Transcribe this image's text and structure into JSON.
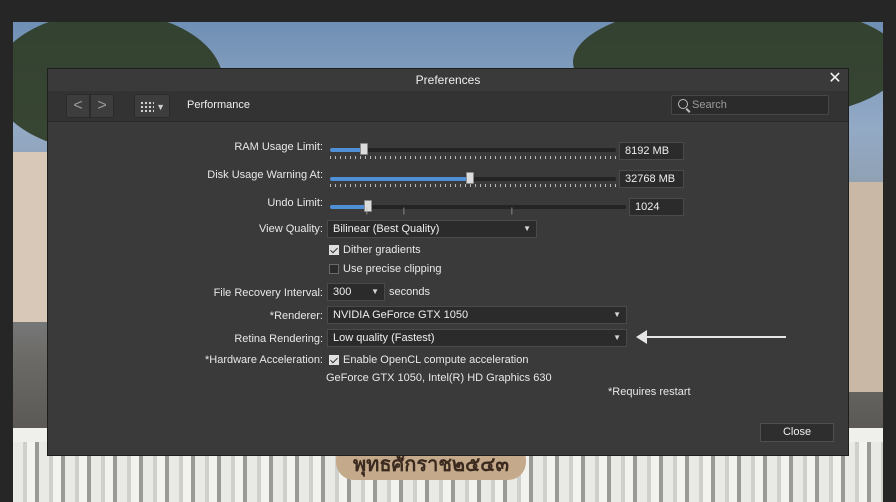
{
  "window": {
    "title": "Preferences"
  },
  "toolbar": {
    "back_glyph": "<",
    "forward_glyph": ">",
    "section_title": "Performance",
    "search_placeholder": "Search"
  },
  "settings": {
    "ram": {
      "label": "RAM Usage Limit:",
      "value": "8192 MB",
      "level": 0.12
    },
    "disk": {
      "label": "Disk Usage Warning At:",
      "value": "32768 MB",
      "level": 0.49
    },
    "undo": {
      "label": "Undo Limit:",
      "value": "1024",
      "level": 0.13
    },
    "view_quality": {
      "label": "View Quality:",
      "value": "Bilinear (Best Quality)"
    },
    "dither": {
      "label": "Dither gradients",
      "checked": true
    },
    "precise_clipping": {
      "label": "Use precise clipping",
      "checked": false
    },
    "file_recovery": {
      "label": "File Recovery Interval:",
      "value": "300",
      "unit": "seconds"
    },
    "renderer": {
      "label": "*Renderer:",
      "value": "NVIDIA GeForce GTX 1050"
    },
    "retina": {
      "label": "Retina Rendering:",
      "value": "Low quality (Fastest)"
    },
    "hw_accel": {
      "label": "*Hardware Acceleration:",
      "checkbox_label": "Enable OpenCL compute acceleration",
      "checked": true,
      "devices": "GeForce GTX 1050, Intel(R) HD Graphics 630"
    },
    "restart_note": "*Requires restart"
  },
  "footer": {
    "close_label": "Close"
  },
  "background_sign_text": "พุทธศักราช๒๕๔๓",
  "colors": {
    "accent": "#4f8fd6",
    "dialog_bg": "#3a3a3a",
    "field_bg": "#2b2b2b"
  },
  "icons": [
    "back-arrow-icon",
    "forward-arrow-icon",
    "grid-icon",
    "search-icon",
    "close-icon",
    "dropdown-arrow-icon",
    "annotation-arrow"
  ]
}
